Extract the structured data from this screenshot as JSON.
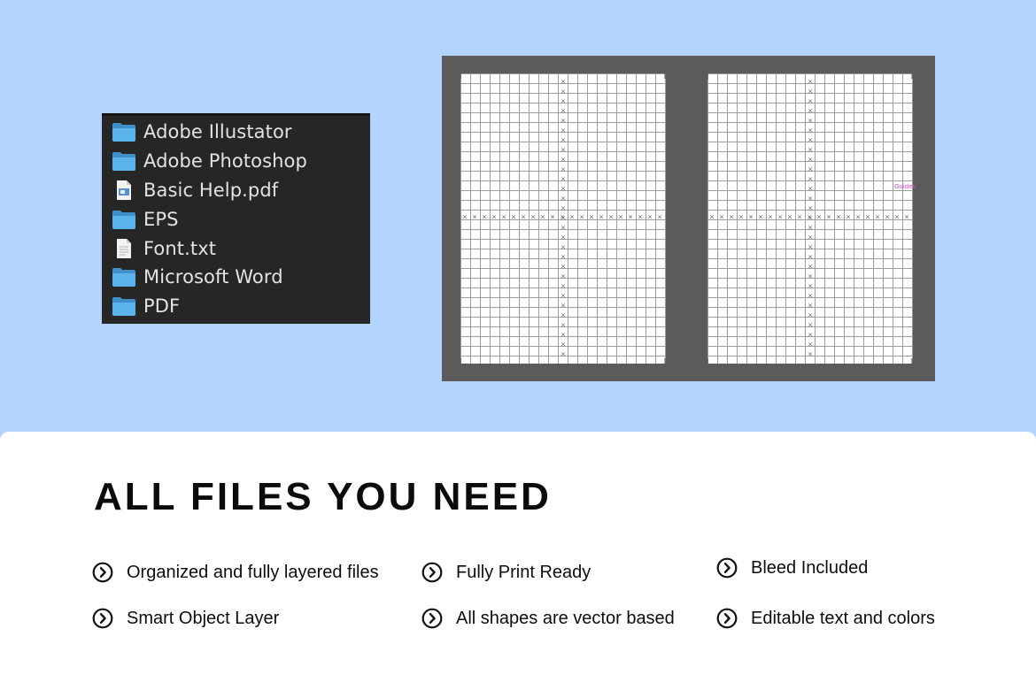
{
  "colors": {
    "background": "#b3d4fe",
    "file_panel": "#262627",
    "folder_blue": "#5ab3ec",
    "preview_frame": "#5b5b5b",
    "guide_magenta": "#d442d4",
    "card": "#ffffff"
  },
  "file_browser": {
    "items": [
      {
        "label": "Adobe Illustator",
        "icon": "folder-icon"
      },
      {
        "label": "Adobe Photoshop",
        "icon": "folder-icon"
      },
      {
        "label": "Basic Help.pdf",
        "icon": "pdf-file-icon"
      },
      {
        "label": "EPS",
        "icon": "folder-icon"
      },
      {
        "label": "Font.txt",
        "icon": "text-file-icon"
      },
      {
        "label": "Microsoft Word",
        "icon": "folder-icon"
      },
      {
        "label": "PDF",
        "icon": "folder-icon"
      }
    ]
  },
  "preview": {
    "guide_label": "Guides"
  },
  "features": {
    "headline": "ALL FILES YOU NEED",
    "icon": "chevron-circle-icon",
    "items": [
      {
        "label": "Organized and fully layered files"
      },
      {
        "label": "Fully Print Ready"
      },
      {
        "label": "Bleed Included"
      },
      {
        "label": "Smart Object Layer"
      },
      {
        "label": "All shapes are vector based"
      },
      {
        "label": "Editable text and colors"
      }
    ]
  }
}
